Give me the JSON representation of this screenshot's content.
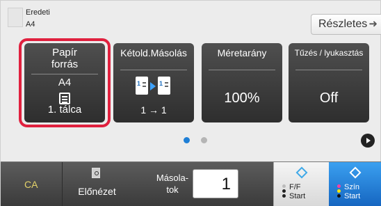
{
  "header": {
    "original_label": "Eredeti",
    "original_size": "A4",
    "detail_button": "Részletes"
  },
  "tiles": {
    "paper": {
      "title": "Papír\nforrás",
      "size": "A4",
      "tray": "1. tálca"
    },
    "duplex": {
      "title": "Kétold.Másolás",
      "value": "1 → 1"
    },
    "ratio": {
      "title": "Méretarány",
      "value": "100%"
    },
    "staple": {
      "title": "Tűzés / lyukasztás",
      "value": "Off"
    }
  },
  "pager": {
    "current": 1,
    "total": 2
  },
  "bottom": {
    "ca": "CA",
    "preview": "Előnézet",
    "copies_label": "Másola-\ntok",
    "copies_value": "1",
    "start_bw_line1": "F/F",
    "start_bw_line2": "Start",
    "start_color_line1": "Szín",
    "start_color_line2": "Start"
  },
  "colors": {
    "highlight": "#e0203e",
    "accent": "#1e7fd6",
    "ca_text": "#e4d36a"
  },
  "icons": [
    "original-doc-icon",
    "arrow-right-icon",
    "paper-tray-icon",
    "duplex-icon",
    "next-page-icon",
    "preview-icon",
    "start-diamond-icon"
  ]
}
